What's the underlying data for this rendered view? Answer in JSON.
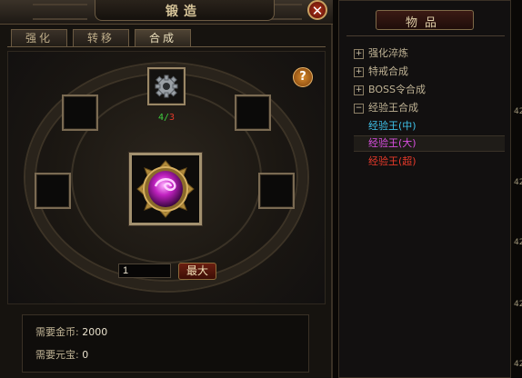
{
  "forge": {
    "title": "锻造",
    "close_label": "✕",
    "help_label": "?",
    "tabs": [
      {
        "label": "强化"
      },
      {
        "label": "转移"
      },
      {
        "label": "合成",
        "active": true
      }
    ],
    "material_count": {
      "have": "4",
      "separator": "/",
      "need": "3"
    },
    "quantity_value": "1",
    "max_label": "最大",
    "gold_label": "需要金币:",
    "gold_value": "2000",
    "yuanbao_label": "需要元宝:",
    "yuanbao_value": "0"
  },
  "items_panel": {
    "title": "物品",
    "categories": [
      {
        "label": "强化淬炼",
        "toggle": "+"
      },
      {
        "label": "特戒合成",
        "toggle": "+"
      },
      {
        "label": "BOSS令合成",
        "toggle": "+"
      },
      {
        "label": "经验王合成",
        "toggle": "−"
      }
    ],
    "subitems": [
      {
        "label": "经验王(中)",
        "color": "#3fc1e8"
      },
      {
        "label": "经验王(大)",
        "color": "#d84fe0"
      },
      {
        "label": "经验王(超)",
        "color": "#e83a2a"
      }
    ]
  },
  "edge_numbers": [
    "42",
    "42",
    "42",
    "42",
    "42"
  ],
  "colors": {
    "gold_text": "#d8c69a",
    "count_have": "#3fcf3f",
    "count_need": "#e23a2a"
  }
}
